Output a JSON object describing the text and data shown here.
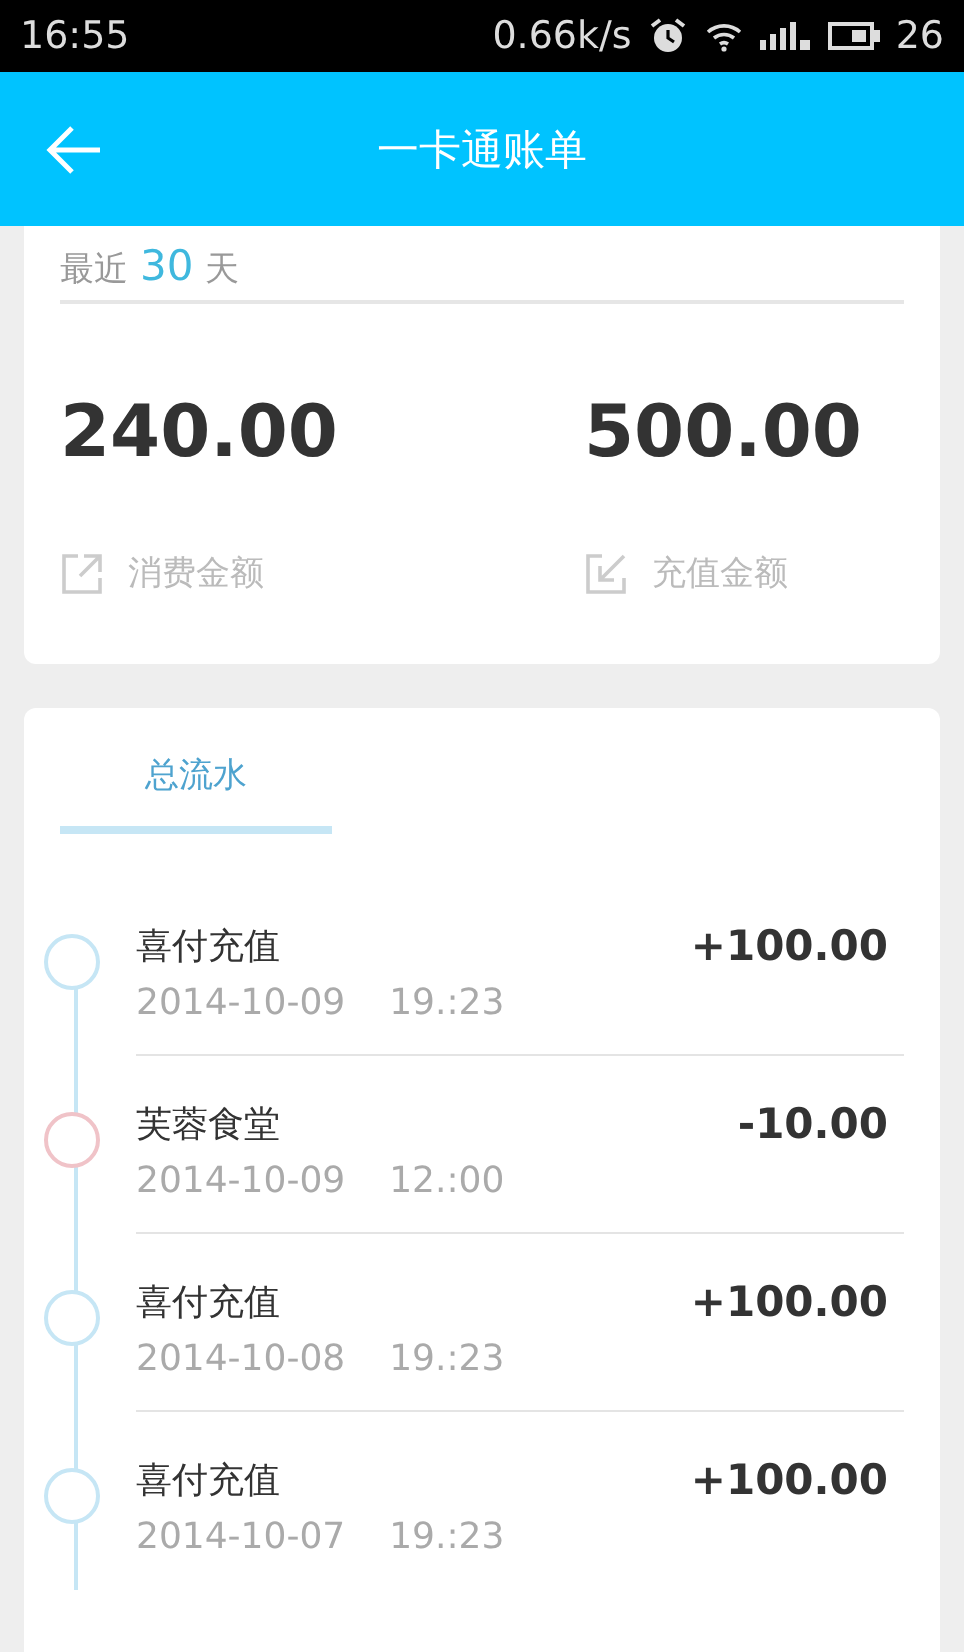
{
  "status_bar": {
    "time": "16:55",
    "speed": "0.66k/s",
    "battery": "26"
  },
  "header": {
    "title": "一卡通账单"
  },
  "summary": {
    "period_prefix": "最近",
    "period_value": "30",
    "period_suffix": "天",
    "stats": [
      {
        "kind": "spend",
        "amount": "240.00",
        "label": "消费金额"
      },
      {
        "kind": "recharge",
        "amount": "500.00",
        "label": "充值金额"
      }
    ]
  },
  "tabs": [
    {
      "label": "总流水",
      "selected": true
    }
  ],
  "transactions": [
    {
      "title": "喜付充值",
      "date": "2014-10-09",
      "time": "19.:23",
      "amount": "+100.00",
      "color": "#c6e6f5"
    },
    {
      "title": "芙蓉食堂",
      "date": "2014-10-09",
      "time": "12.:00",
      "amount": "-10.00",
      "color": "#f0c3c8"
    },
    {
      "title": "喜付充值",
      "date": "2014-10-08",
      "time": "19.:23",
      "amount": "+100.00",
      "color": "#c6e6f5"
    },
    {
      "title": "喜付充值",
      "date": "2014-10-07",
      "time": "19.:23",
      "amount": "+100.00",
      "color": "#c6e6f5"
    }
  ]
}
